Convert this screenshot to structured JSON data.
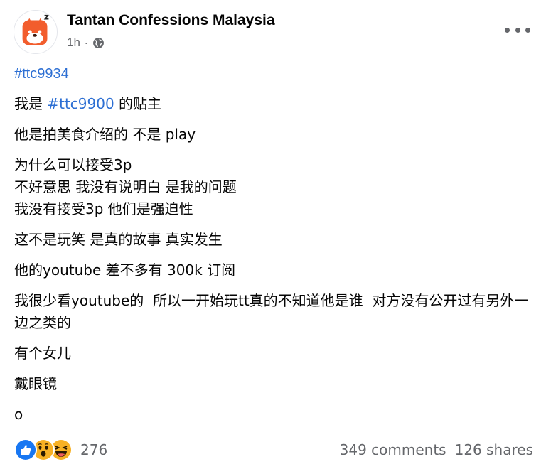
{
  "post": {
    "page_name": "Tantan Confessions Malaysia",
    "time": "1h",
    "separator": "·",
    "audience_icon": "globe-icon",
    "hashtag": "#ttc9934",
    "line1_before": "我是 ",
    "line1_tag": "#ttc9900",
    "line1_after": " 的贴主",
    "paragraphs": [
      "他是拍美食介绍的 不是 play",
      "为什么可以接受3p\n不好意思 我没有说明白 是我的问题\n我没有接受3p 他们是强迫性",
      "这不是玩笑 是真的故事 真实发生",
      "他的youtube 差不多有 300k 订阅",
      "我很少看youtube的  所以一开始玩tt真的不知道他是谁  对方没有公开过有另外一边之类的",
      "有个女儿",
      "戴眼镜",
      "o"
    ]
  },
  "footer": {
    "reaction_icons": [
      "like-icon",
      "wow-icon",
      "haha-icon"
    ],
    "reaction_count": "276",
    "comments": "349 comments",
    "shares": "126 shares"
  },
  "colors": {
    "link": "#2d6fd3",
    "secondary_text": "#65676b",
    "like_blue": "#1877f2",
    "emoji_yellow": "#f7b125",
    "avatar_orange": "#f25d2d"
  }
}
